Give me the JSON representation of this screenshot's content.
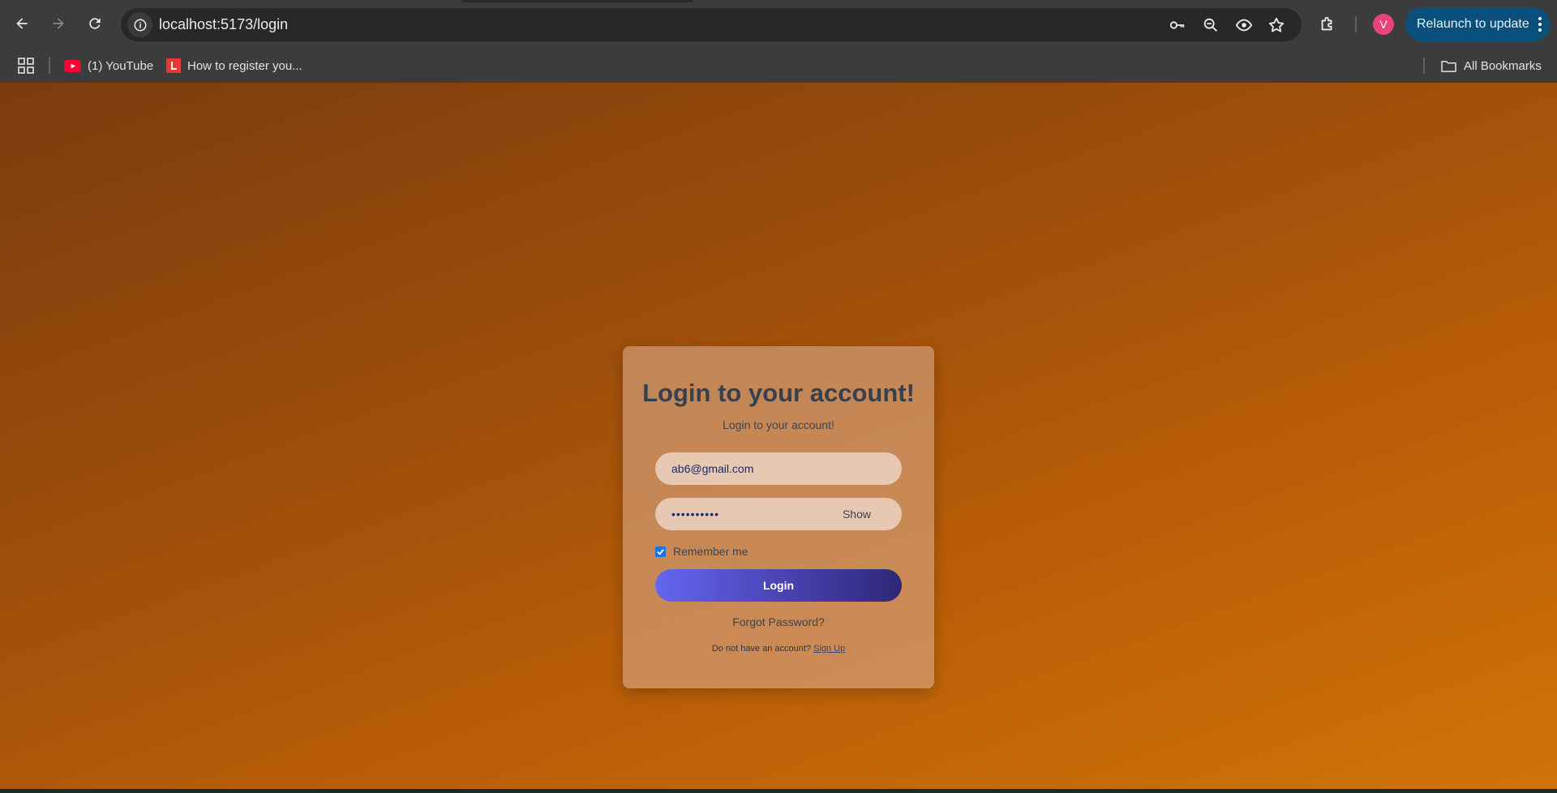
{
  "browser": {
    "url": "localhost:5173/login",
    "profile_initial": "V",
    "relaunch_label": "Relaunch to update",
    "bookmarks": [
      {
        "label": "(1) YouTube",
        "icon": "youtube-icon"
      },
      {
        "label": "How to register you...",
        "icon": "l-logo-icon"
      }
    ],
    "all_bookmarks_label": "All Bookmarks"
  },
  "login": {
    "title": "Login to your account!",
    "subtitle": "Login to your account!",
    "email_value": "ab6@gmail.com",
    "password_masked": "••••••••••",
    "show_label": "Show",
    "remember_label": "Remember me",
    "remember_checked": true,
    "login_button": "Login",
    "forgot_label": "Forgot Password?",
    "no_account_text": "Do not have an account?",
    "signup_link": "Sign Up"
  },
  "colors": {
    "bg_start": "#7b3c0e",
    "bg_end": "#d07408",
    "button_start": "#6366f1",
    "button_end": "#2e2777",
    "relaunch_bg": "#0b4f7c",
    "avatar_bg": "#e8437a"
  }
}
